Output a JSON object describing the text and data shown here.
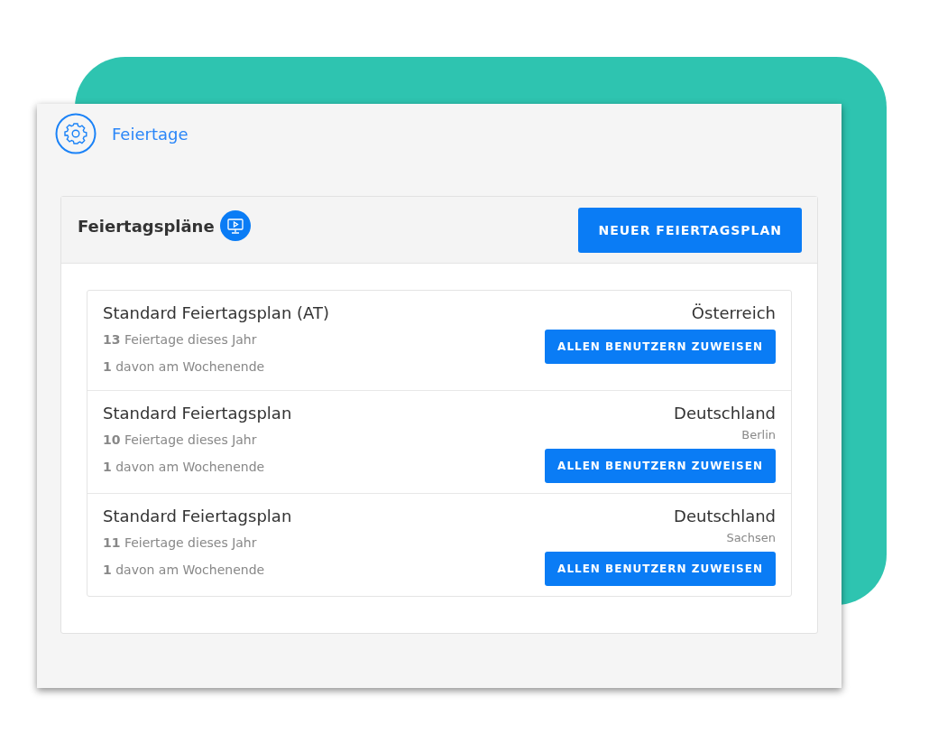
{
  "header": {
    "title": "Feiertage"
  },
  "panel": {
    "title": "Feiertagspläne",
    "new_button": "NEUER FEIERTAGSPLAN"
  },
  "plans": [
    {
      "name": "Standard Feiertagsplan (AT)",
      "holidays": "**13** Feiertage dieses Jahr",
      "weekend": "**1** davon am Wochenende",
      "country": "Österreich",
      "assign_button": "ALLEN BENUTZERN ZUWEISEN"
    },
    {
      "name": "Standard Feiertagsplan",
      "holidays": "**10** Feiertage dieses Jahr",
      "weekend": "**1** davon am Wochenende",
      "country": "Deutschland",
      "region": "Berlin",
      "assign_button": "ALLEN BENUTZERN ZUWEISEN"
    },
    {
      "name": "Standard Feiertagsplan",
      "holidays": "**11** Feiertage dieses Jahr",
      "weekend": "**1** davon am Wochenende",
      "country": "Deutschland",
      "region": "Sachsen",
      "assign_button": "ALLEN BENUTZERN ZUWEISEN"
    }
  ]
}
